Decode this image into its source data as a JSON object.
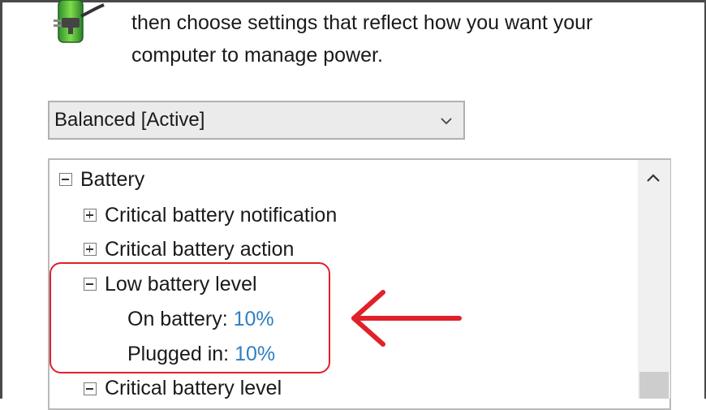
{
  "header": {
    "line1": "then choose settings that reflect how you want your",
    "line2": "computer to manage power.",
    "icon": "power-plug-icon"
  },
  "plan_select": {
    "selected": "Balanced [Active]",
    "icon": "chevron-down-icon"
  },
  "tree": {
    "battery": {
      "label": "Battery",
      "expanded": true
    },
    "critical_notification": {
      "label": "Critical battery notification",
      "expanded": false
    },
    "critical_action": {
      "label": "Critical battery action",
      "expanded": false
    },
    "low_level": {
      "label": "Low battery level",
      "expanded": true,
      "on_battery_label": "On battery:",
      "on_battery_value": "10%",
      "plugged_in_label": "Plugged in:",
      "plugged_in_value": "10%"
    },
    "critical_level": {
      "label": "Critical battery level",
      "expanded": true
    }
  },
  "annotation": {
    "highlight_color": "#e0212a",
    "arrow_icon": "left-arrow-icon"
  }
}
